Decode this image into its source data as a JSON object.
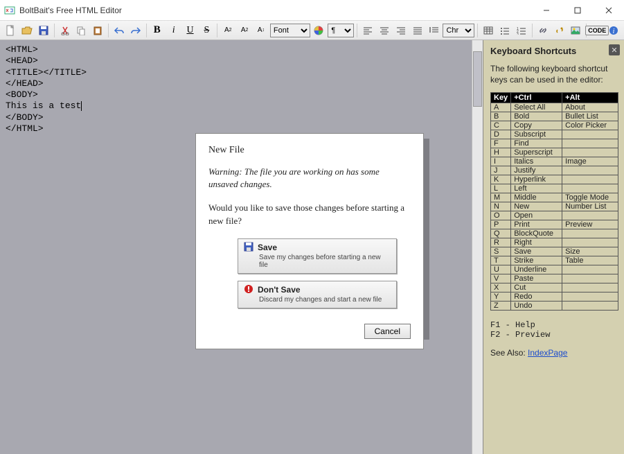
{
  "window": {
    "title": "BoltBait's Free HTML Editor"
  },
  "toolbar": {
    "font_label": "Font",
    "char_label": "Chr",
    "code_label": "CODE"
  },
  "editor": {
    "lines": [
      "<HTML>",
      "<HEAD>",
      "<TITLE></TITLE>",
      "</HEAD>",
      "<BODY>",
      "This is a test",
      "</BODY>",
      "</HTML>"
    ]
  },
  "dialog": {
    "title": "New File",
    "warning": "Warning: The file you are working on has some unsaved changes.",
    "prompt": "Would you like to save those changes before starting a new file?",
    "save_label": "Save",
    "save_sub": "Save my changes before starting a new file",
    "dont_label": "Don't Save",
    "dont_sub": "Discard my changes and start a new file",
    "cancel_label": "Cancel"
  },
  "sidebar": {
    "heading": "Keyboard Shortcuts",
    "intro": "The following keyboard shortcut keys can be used in the editor:",
    "headers": {
      "key": "Key",
      "ctrl": "+Ctrl",
      "alt": "+Alt"
    },
    "rows": [
      {
        "k": "A",
        "c": "Select All",
        "a": "About"
      },
      {
        "k": "B",
        "c": "Bold",
        "a": "Bullet List"
      },
      {
        "k": "C",
        "c": "Copy",
        "a": "Color Picker"
      },
      {
        "k": "D",
        "c": "Subscript",
        "a": ""
      },
      {
        "k": "F",
        "c": "Find",
        "a": ""
      },
      {
        "k": "H",
        "c": "Superscript",
        "a": ""
      },
      {
        "k": "I",
        "c": "Italics",
        "a": "Image"
      },
      {
        "k": "J",
        "c": "Justify",
        "a": ""
      },
      {
        "k": "K",
        "c": "Hyperlink",
        "a": ""
      },
      {
        "k": "L",
        "c": "Left",
        "a": ""
      },
      {
        "k": "M",
        "c": "Middle",
        "a": "Toggle Mode"
      },
      {
        "k": "N",
        "c": "New",
        "a": "Number List"
      },
      {
        "k": "O",
        "c": "Open",
        "a": ""
      },
      {
        "k": "P",
        "c": "Print",
        "a": "Preview"
      },
      {
        "k": "Q",
        "c": "BlockQuote",
        "a": ""
      },
      {
        "k": "R",
        "c": "Right",
        "a": ""
      },
      {
        "k": "S",
        "c": "Save",
        "a": "Size"
      },
      {
        "k": "T",
        "c": "Strike",
        "a": "Table"
      },
      {
        "k": "U",
        "c": "Underline",
        "a": ""
      },
      {
        "k": "V",
        "c": "Paste",
        "a": ""
      },
      {
        "k": "X",
        "c": "Cut",
        "a": ""
      },
      {
        "k": "Y",
        "c": "Redo",
        "a": ""
      },
      {
        "k": "Z",
        "c": "Undo",
        "a": ""
      }
    ],
    "f1": "F1 - Help",
    "f2": "F2 - Preview",
    "see_also_label": "See Also:",
    "see_also_link": "IndexPage"
  }
}
